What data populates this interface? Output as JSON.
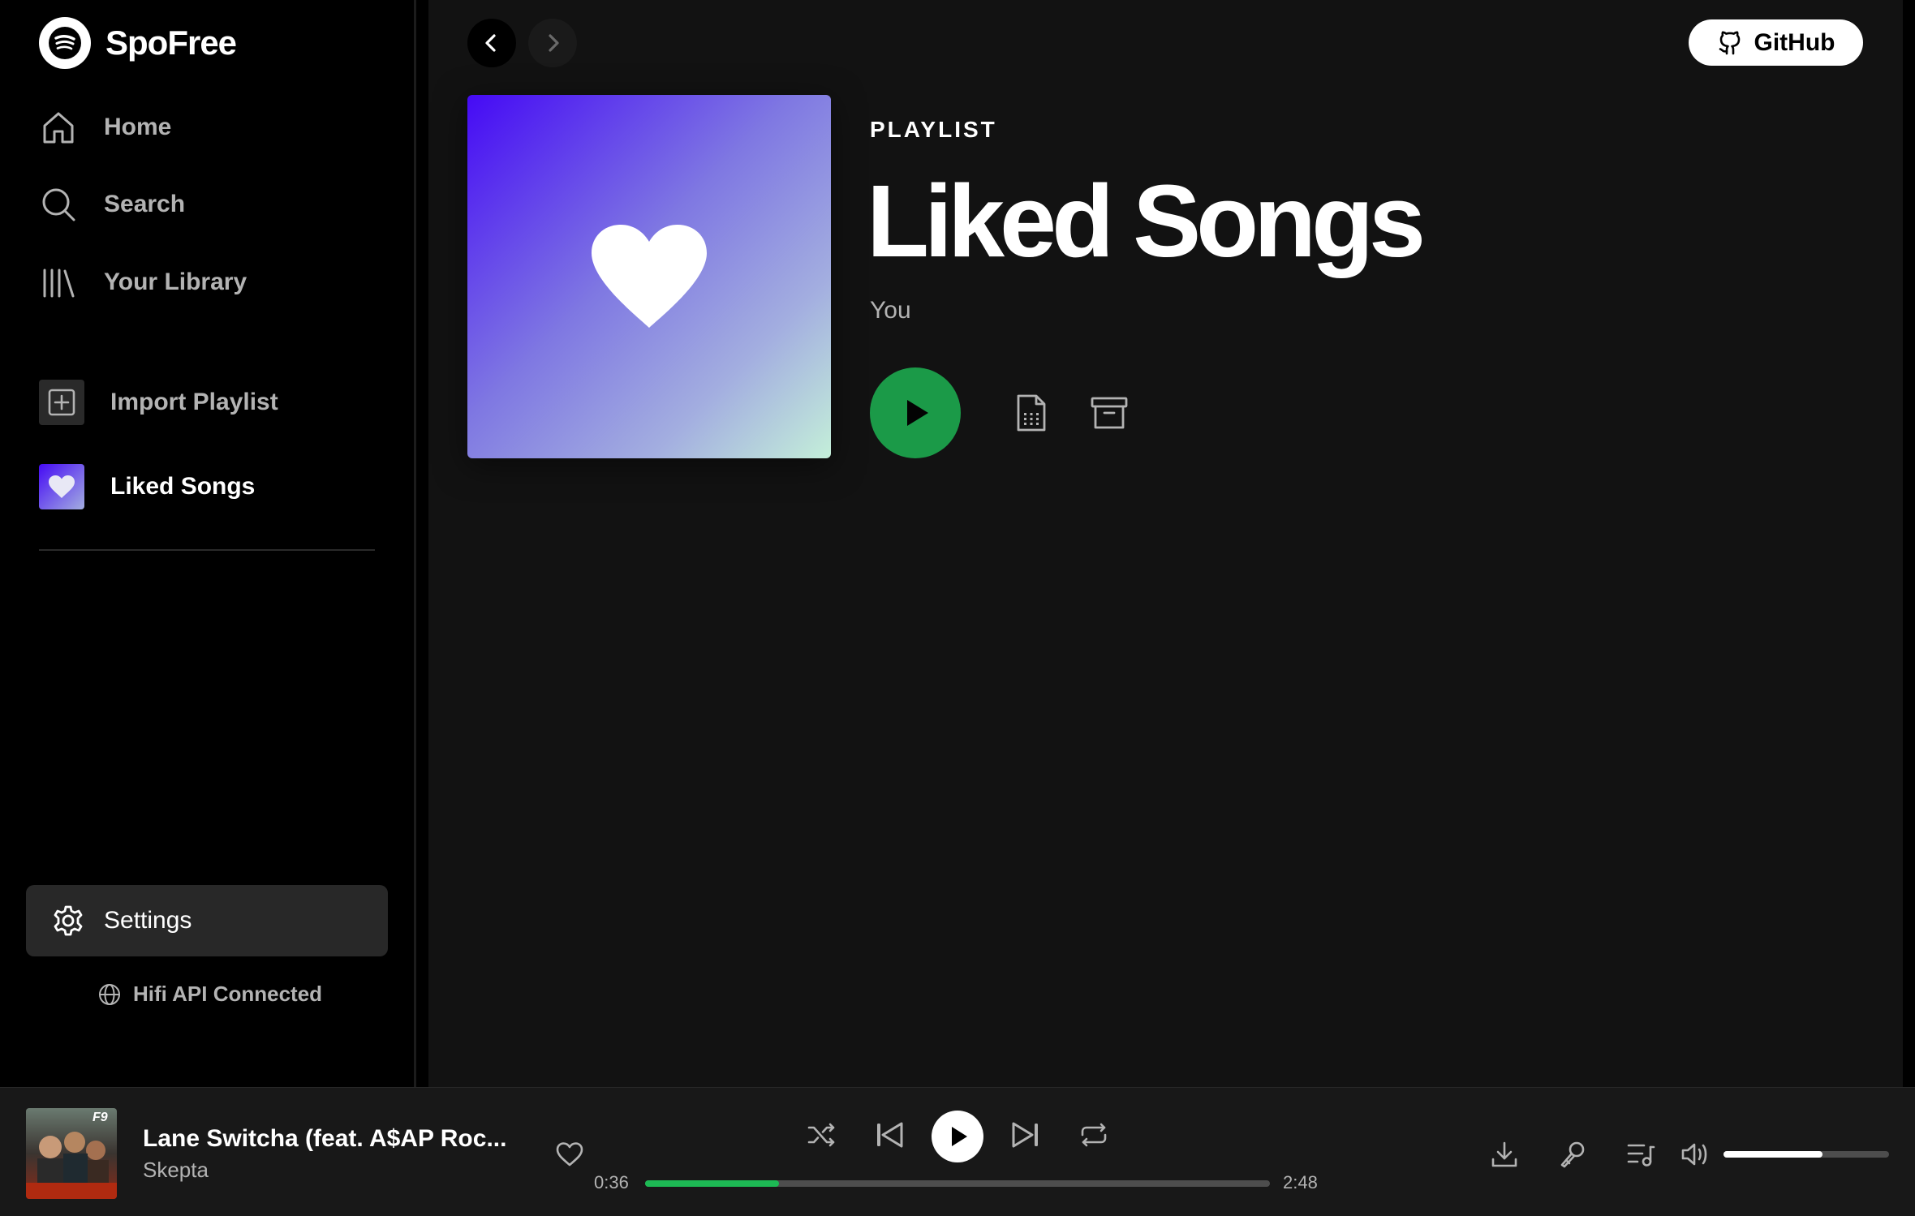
{
  "app": {
    "name": "SpoFree"
  },
  "sidebar": {
    "nav": [
      {
        "label": "Home",
        "icon": "home-icon"
      },
      {
        "label": "Search",
        "icon": "search-icon"
      },
      {
        "label": "Your Library",
        "icon": "library-icon"
      }
    ],
    "library": [
      {
        "label": "Import Playlist",
        "icon": "plus-square-icon"
      },
      {
        "label": "Liked Songs",
        "icon": "heart-icon"
      }
    ],
    "settings_label": "Settings",
    "api_status": "Hifi API Connected"
  },
  "header": {
    "github_label": "GitHub"
  },
  "playlist": {
    "type": "PLAYLIST",
    "title": "Liked Songs",
    "owner": "You"
  },
  "player": {
    "track_title": "Lane Switcha (feat. A$AP Roc...",
    "artist": "Skepta",
    "elapsed": "0:36",
    "duration": "2:48",
    "progress_fraction": 0.214,
    "volume_fraction": 0.6
  },
  "colors": {
    "accent": "#1db954",
    "background": "#121212",
    "sidebar": "#000000",
    "player_bar": "#181818"
  }
}
